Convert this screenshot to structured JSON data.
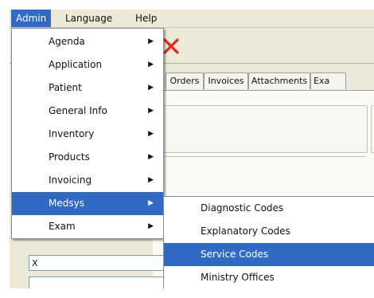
{
  "menubar": {
    "items": [
      {
        "label": "Admin"
      },
      {
        "label": "Language"
      },
      {
        "label": "Help"
      }
    ]
  },
  "tabs": [
    {
      "label": "Orders"
    },
    {
      "label": "Invoices"
    },
    {
      "label": "Attachments"
    },
    {
      "label": "Exa"
    }
  ],
  "admin_menu": {
    "items": [
      {
        "label": "Agenda",
        "arrow": "▶"
      },
      {
        "label": "Application",
        "arrow": "▶"
      },
      {
        "label": "Patient",
        "arrow": "▶"
      },
      {
        "label": "General Info",
        "arrow": "▶"
      },
      {
        "label": "Inventory",
        "arrow": "▶"
      },
      {
        "label": "Products",
        "arrow": "▶"
      },
      {
        "label": "Invoicing",
        "arrow": "▶"
      },
      {
        "label": "Medsys",
        "arrow": "▶"
      },
      {
        "label": "Exam",
        "arrow": "▶"
      }
    ]
  },
  "medsys_submenu": {
    "items": [
      {
        "label": "Diagnostic Codes"
      },
      {
        "label": "Explanatory Codes"
      },
      {
        "label": "Service Codes"
      },
      {
        "label": "Ministry Offices"
      }
    ]
  },
  "fields": {
    "field1_value": "X",
    "field2_value": ""
  },
  "colors": {
    "highlight": "#316ac5",
    "close_icon": "#e8251b"
  },
  "icons": {
    "toolbar_close": "close-icon",
    "submenu_arrow": "chevron-right-icon"
  }
}
